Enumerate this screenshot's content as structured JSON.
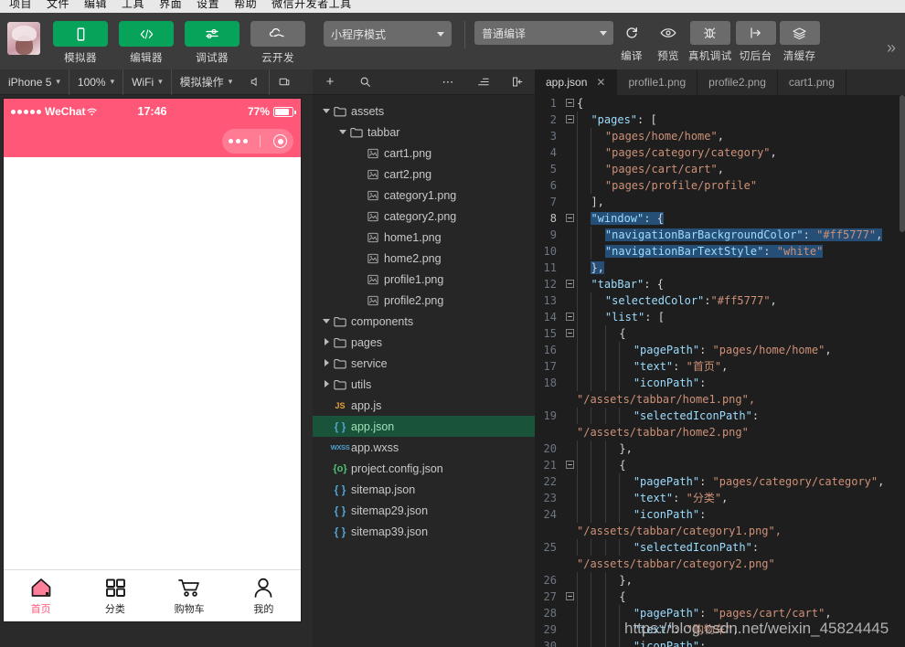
{
  "menubar": {
    "items": [
      "项目",
      "文件",
      "编辑",
      "工具",
      "界面",
      "设置",
      "帮助",
      "微信开发者工具"
    ]
  },
  "toolbar": {
    "avatar_name": "user-avatar",
    "buttons": [
      {
        "label": "模拟器",
        "icon": "phone-icon",
        "style": "green"
      },
      {
        "label": "编辑器",
        "icon": "code-icon",
        "style": "green"
      },
      {
        "label": "调试器",
        "icon": "debug-sliders-icon",
        "style": "green"
      },
      {
        "label": "云开发",
        "icon": "cloud-icon",
        "style": "grey"
      }
    ],
    "mode_select": "小程序模式",
    "compile_select": "普通编译",
    "actions": [
      {
        "label": "编译",
        "icon": "refresh-icon"
      },
      {
        "label": "预览",
        "icon": "eye-icon"
      },
      {
        "label": "真机调试",
        "icon": "bug-icon"
      },
      {
        "label": "切后台",
        "icon": "background-icon"
      },
      {
        "label": "清缓存",
        "icon": "layers-icon"
      }
    ],
    "overflow": "»"
  },
  "simulator": {
    "toolbar": {
      "device": "iPhone 5",
      "zoom": "100%",
      "network": "WiFi",
      "simulate": "模拟操作",
      "icons": [
        "volume-icon",
        "rotate-icon"
      ]
    },
    "status_bar": {
      "carrier": "WeChat",
      "time": "17:46",
      "battery": "77%"
    },
    "tabbar": [
      {
        "text": "首页",
        "icon": "home-icon",
        "active": true
      },
      {
        "text": "分类",
        "icon": "grid-icon",
        "active": false
      },
      {
        "text": "购物车",
        "icon": "cart-icon",
        "active": false
      },
      {
        "text": "我的",
        "icon": "person-icon",
        "active": false
      }
    ],
    "theme_color": "#ff5777"
  },
  "file_tree": {
    "toolbar_icons": [
      "add-icon",
      "search-icon",
      "more-icon",
      "sort-icon",
      "collapse-icon"
    ],
    "items": [
      {
        "label": "assets",
        "depth": 0,
        "type": "folder",
        "state": "open"
      },
      {
        "label": "tabbar",
        "depth": 1,
        "type": "folder",
        "state": "open"
      },
      {
        "label": "cart1.png",
        "depth": 2,
        "type": "image"
      },
      {
        "label": "cart2.png",
        "depth": 2,
        "type": "image"
      },
      {
        "label": "category1.png",
        "depth": 2,
        "type": "image"
      },
      {
        "label": "category2.png",
        "depth": 2,
        "type": "image"
      },
      {
        "label": "home1.png",
        "depth": 2,
        "type": "image"
      },
      {
        "label": "home2.png",
        "depth": 2,
        "type": "image"
      },
      {
        "label": "profile1.png",
        "depth": 2,
        "type": "image"
      },
      {
        "label": "profile2.png",
        "depth": 2,
        "type": "image"
      },
      {
        "label": "components",
        "depth": 0,
        "type": "folder",
        "state": "open"
      },
      {
        "label": "pages",
        "depth": 0,
        "type": "folder",
        "state": "closed"
      },
      {
        "label": "service",
        "depth": 0,
        "type": "folder",
        "state": "closed"
      },
      {
        "label": "utils",
        "depth": 0,
        "type": "folder",
        "state": "closed"
      },
      {
        "label": "app.js",
        "depth": 0,
        "type": "js"
      },
      {
        "label": "app.json",
        "depth": 0,
        "type": "json",
        "selected": true
      },
      {
        "label": "app.wxss",
        "depth": 0,
        "type": "wxss"
      },
      {
        "label": "project.config.json",
        "depth": 0,
        "type": "jsonc"
      },
      {
        "label": "sitemap.json",
        "depth": 0,
        "type": "json"
      },
      {
        "label": "sitemap29.json",
        "depth": 0,
        "type": "json"
      },
      {
        "label": "sitemap39.json",
        "depth": 0,
        "type": "json"
      }
    ]
  },
  "editor": {
    "tabs": [
      {
        "label": "app.json",
        "active": true,
        "closable": true
      },
      {
        "label": "profile1.png",
        "active": false,
        "closable": false
      },
      {
        "label": "profile2.png",
        "active": false,
        "closable": false
      },
      {
        "label": "cart1.png",
        "active": false,
        "closable": false
      }
    ],
    "lines": [
      {
        "n": 1,
        "fold": "minus",
        "indent": 0,
        "sel": false,
        "tokens": [
          {
            "t": "{",
            "c": "b"
          }
        ]
      },
      {
        "n": 2,
        "fold": "minus",
        "indent": 1,
        "sel": false,
        "tokens": [
          {
            "t": "\"pages\"",
            "c": "k"
          },
          {
            "t": ": [",
            "c": "p"
          }
        ]
      },
      {
        "n": 3,
        "fold": "",
        "indent": 2,
        "sel": false,
        "tokens": [
          {
            "t": "\"pages/home/home\"",
            "c": "s"
          },
          {
            "t": ",",
            "c": "p"
          }
        ]
      },
      {
        "n": 4,
        "fold": "",
        "indent": 2,
        "sel": false,
        "tokens": [
          {
            "t": "\"pages/category/category\"",
            "c": "s"
          },
          {
            "t": ",",
            "c": "p"
          }
        ]
      },
      {
        "n": 5,
        "fold": "",
        "indent": 2,
        "sel": false,
        "tokens": [
          {
            "t": "\"pages/cart/cart\"",
            "c": "s"
          },
          {
            "t": ",",
            "c": "p"
          }
        ]
      },
      {
        "n": 6,
        "fold": "",
        "indent": 2,
        "sel": false,
        "tokens": [
          {
            "t": "\"pages/profile/profile\"",
            "c": "s"
          }
        ]
      },
      {
        "n": 7,
        "fold": "",
        "indent": 1,
        "sel": false,
        "tokens": [
          {
            "t": "],",
            "c": "p"
          }
        ]
      },
      {
        "n": 8,
        "fold": "minus",
        "indent": 1,
        "sel": true,
        "tokens": [
          {
            "t": "\"window\"",
            "c": "k"
          },
          {
            "t": ": {",
            "c": "p"
          }
        ]
      },
      {
        "n": 9,
        "fold": "",
        "indent": 2,
        "sel": true,
        "tokens": [
          {
            "t": "\"navigationBarBackgroundColor\"",
            "c": "k"
          },
          {
            "t": ": ",
            "c": "p"
          },
          {
            "t": "\"#ff5777\"",
            "c": "s"
          },
          {
            "t": ",",
            "c": "p"
          }
        ]
      },
      {
        "n": 10,
        "fold": "",
        "indent": 2,
        "sel": true,
        "tokens": [
          {
            "t": "\"navigationBarTextStyle\"",
            "c": "k"
          },
          {
            "t": ": ",
            "c": "p"
          },
          {
            "t": "\"white\"",
            "c": "s"
          }
        ]
      },
      {
        "n": 11,
        "fold": "",
        "indent": 1,
        "sel": true,
        "tokens": [
          {
            "t": "},",
            "c": "p"
          }
        ]
      },
      {
        "n": 12,
        "fold": "minus",
        "indent": 1,
        "sel": false,
        "tokens": [
          {
            "t": "\"tabBar\"",
            "c": "k"
          },
          {
            "t": ": {",
            "c": "p"
          }
        ]
      },
      {
        "n": 13,
        "fold": "",
        "indent": 2,
        "sel": false,
        "tokens": [
          {
            "t": "\"selectedColor\"",
            "c": "k"
          },
          {
            "t": ":",
            "c": "p"
          },
          {
            "t": "\"#ff5777\"",
            "c": "s"
          },
          {
            "t": ",",
            "c": "p"
          }
        ]
      },
      {
        "n": 14,
        "fold": "minus",
        "indent": 2,
        "sel": false,
        "tokens": [
          {
            "t": "\"list\"",
            "c": "k"
          },
          {
            "t": ": [",
            "c": "p"
          }
        ]
      },
      {
        "n": 15,
        "fold": "minus",
        "indent": 3,
        "sel": false,
        "tokens": [
          {
            "t": "{",
            "c": "p"
          }
        ]
      },
      {
        "n": 16,
        "fold": "",
        "indent": 4,
        "sel": false,
        "tokens": [
          {
            "t": "\"pagePath\"",
            "c": "k"
          },
          {
            "t": ": ",
            "c": "p"
          },
          {
            "t": "\"pages/home/home\"",
            "c": "s"
          },
          {
            "t": ",",
            "c": "p"
          }
        ]
      },
      {
        "n": 17,
        "fold": "",
        "indent": 4,
        "sel": false,
        "tokens": [
          {
            "t": "\"text\"",
            "c": "k"
          },
          {
            "t": ": ",
            "c": "p"
          },
          {
            "t": "\"首页\"",
            "c": "s"
          },
          {
            "t": ",",
            "c": "p"
          }
        ]
      },
      {
        "n": 18,
        "fold": "",
        "indent": 4,
        "sel": false,
        "wrap": "\"/assets/tabbar/home1.png\",",
        "tokens": [
          {
            "t": "\"iconPath\"",
            "c": "k"
          },
          {
            "t": ":",
            "c": "p"
          }
        ]
      },
      {
        "n": 19,
        "fold": "",
        "indent": 4,
        "sel": false,
        "wrap": "\"/assets/tabbar/home2.png\"",
        "tokens": [
          {
            "t": "\"selectedIconPath\"",
            "c": "k"
          },
          {
            "t": ":",
            "c": "p"
          }
        ]
      },
      {
        "n": 20,
        "fold": "",
        "indent": 3,
        "sel": false,
        "tokens": [
          {
            "t": "},",
            "c": "p"
          }
        ]
      },
      {
        "n": 21,
        "fold": "minus",
        "indent": 3,
        "sel": false,
        "tokens": [
          {
            "t": "{",
            "c": "p"
          }
        ]
      },
      {
        "n": 22,
        "fold": "",
        "indent": 4,
        "sel": false,
        "tokens": [
          {
            "t": "\"pagePath\"",
            "c": "k"
          },
          {
            "t": ": ",
            "c": "p"
          },
          {
            "t": "\"pages/category/category\"",
            "c": "s"
          },
          {
            "t": ",",
            "c": "p"
          }
        ]
      },
      {
        "n": 23,
        "fold": "",
        "indent": 4,
        "sel": false,
        "tokens": [
          {
            "t": "\"text\"",
            "c": "k"
          },
          {
            "t": ": ",
            "c": "p"
          },
          {
            "t": "\"分类\"",
            "c": "s"
          },
          {
            "t": ",",
            "c": "p"
          }
        ]
      },
      {
        "n": 24,
        "fold": "",
        "indent": 4,
        "sel": false,
        "wrap": "\"/assets/tabbar/category1.png\",",
        "tokens": [
          {
            "t": "\"iconPath\"",
            "c": "k"
          },
          {
            "t": ":",
            "c": "p"
          }
        ]
      },
      {
        "n": 25,
        "fold": "",
        "indent": 4,
        "sel": false,
        "wrap": "\"/assets/tabbar/category2.png\"",
        "tokens": [
          {
            "t": "\"selectedIconPath\"",
            "c": "k"
          },
          {
            "t": ":",
            "c": "p"
          }
        ]
      },
      {
        "n": 26,
        "fold": "",
        "indent": 3,
        "sel": false,
        "tokens": [
          {
            "t": "},",
            "c": "p"
          }
        ]
      },
      {
        "n": 27,
        "fold": "minus",
        "indent": 3,
        "sel": false,
        "tokens": [
          {
            "t": "{",
            "c": "p"
          }
        ]
      },
      {
        "n": 28,
        "fold": "",
        "indent": 4,
        "sel": false,
        "tokens": [
          {
            "t": "\"pagePath\"",
            "c": "k"
          },
          {
            "t": ": ",
            "c": "p"
          },
          {
            "t": "\"pages/cart/cart\"",
            "c": "s"
          },
          {
            "t": ",",
            "c": "p"
          }
        ]
      },
      {
        "n": 29,
        "fold": "",
        "indent": 4,
        "sel": false,
        "tokens": [
          {
            "t": "\"text\"",
            "c": "k"
          },
          {
            "t": ": ",
            "c": "p"
          },
          {
            "t": "\"购物车\"",
            "c": "s"
          },
          {
            "t": ",",
            "c": "p"
          }
        ]
      },
      {
        "n": 30,
        "fold": "",
        "indent": 4,
        "sel": false,
        "tokens": [
          {
            "t": "\"iconPath\"",
            "c": "k"
          },
          {
            "t": ":",
            "c": "p"
          }
        ]
      }
    ],
    "watermark": "https://blog.csdn.net/weixin_45824445"
  }
}
